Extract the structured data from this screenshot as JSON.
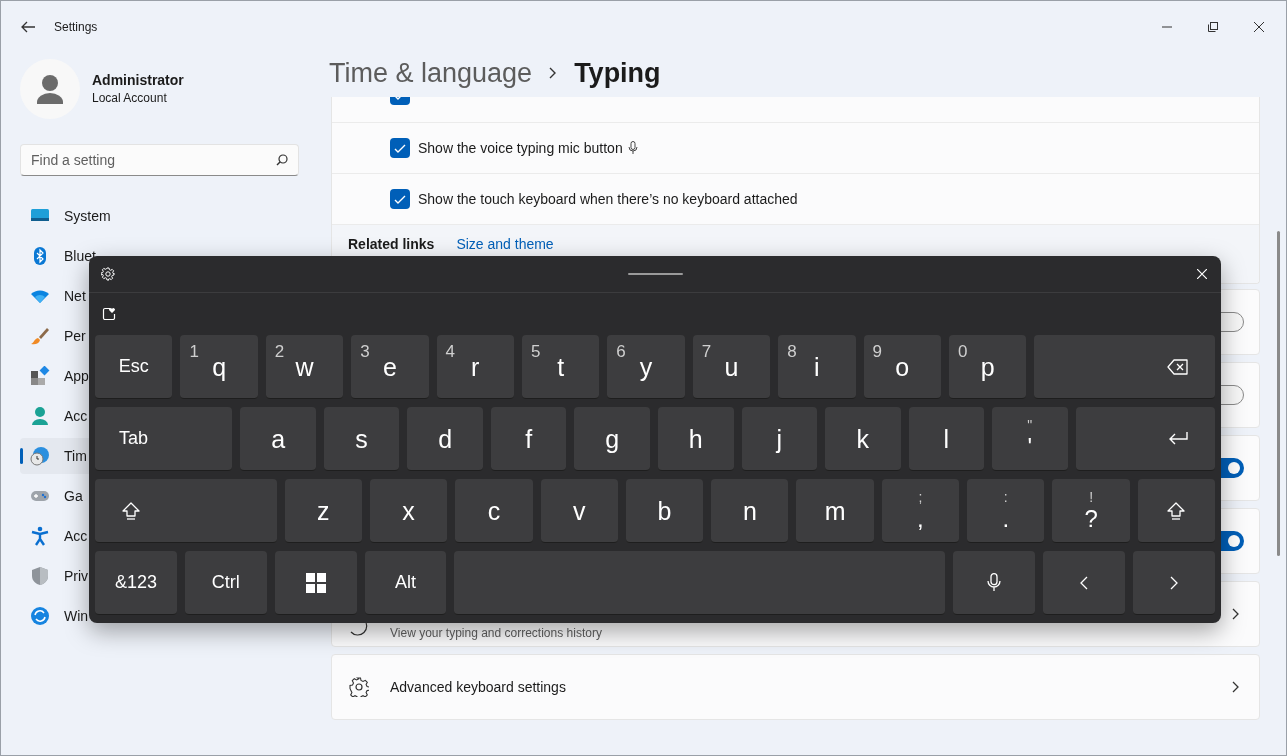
{
  "window": {
    "title": "Settings"
  },
  "account": {
    "name": "Administrator",
    "type": "Local Account"
  },
  "search": {
    "placeholder": "Find a setting"
  },
  "sidebar": {
    "items": [
      {
        "label": "System",
        "selected": false
      },
      {
        "label": "Bluet",
        "selected": false
      },
      {
        "label": "Net",
        "selected": false
      },
      {
        "label": "Per",
        "selected": false
      },
      {
        "label": "App",
        "selected": false
      },
      {
        "label": "Acc",
        "selected": false
      },
      {
        "label": "Tim",
        "selected": true
      },
      {
        "label": "Ga",
        "selected": false
      },
      {
        "label": "Acc",
        "selected": false
      },
      {
        "label": "Priv",
        "selected": false
      },
      {
        "label": "Win",
        "selected": false
      }
    ]
  },
  "breadcrumb": {
    "parent": "Time & language",
    "current": "Typing"
  },
  "checkbox_rows": [
    {
      "kind": "hidden_label",
      "checked": true
    },
    {
      "kind": "mic",
      "label": "Show the voice typing mic button",
      "checked": true
    },
    {
      "kind": "plain",
      "label": "Show the touch keyboard when there’s no keyboard attached",
      "checked": true
    }
  ],
  "related_links": {
    "label": "Related links",
    "links": [
      "Size and theme"
    ]
  },
  "cards": [
    {
      "kind": "toggle",
      "on": false
    },
    {
      "kind": "toggle",
      "on": false
    },
    {
      "kind": "toggle",
      "on": true
    },
    {
      "kind": "toggle",
      "on": true
    },
    {
      "kind": "history",
      "subtitle": "View your typing and corrections history"
    },
    {
      "kind": "gear",
      "title": "Advanced keyboard settings"
    }
  ],
  "keyboard": {
    "rows": [
      [
        {
          "kind": "function",
          "label": "Esc"
        },
        {
          "kind": "char",
          "label": "q",
          "sub": "1"
        },
        {
          "kind": "char",
          "label": "w",
          "sub": "2"
        },
        {
          "kind": "char",
          "label": "e",
          "sub": "3"
        },
        {
          "kind": "char",
          "label": "r",
          "sub": "4"
        },
        {
          "kind": "char",
          "label": "t",
          "sub": "5"
        },
        {
          "kind": "char",
          "label": "y",
          "sub": "6"
        },
        {
          "kind": "char",
          "label": "u",
          "sub": "7"
        },
        {
          "kind": "char",
          "label": "i",
          "sub": "8"
        },
        {
          "kind": "char",
          "label": "o",
          "sub": "9"
        },
        {
          "kind": "char",
          "label": "p",
          "sub": "0"
        },
        {
          "kind": "backspace"
        }
      ],
      [
        {
          "kind": "tab",
          "label": "Tab"
        },
        {
          "kind": "char",
          "label": "a"
        },
        {
          "kind": "char",
          "label": "s"
        },
        {
          "kind": "char",
          "label": "d"
        },
        {
          "kind": "char",
          "label": "f"
        },
        {
          "kind": "char",
          "label": "g"
        },
        {
          "kind": "char",
          "label": "h"
        },
        {
          "kind": "char",
          "label": "j"
        },
        {
          "kind": "char",
          "label": "k"
        },
        {
          "kind": "char",
          "label": "l"
        },
        {
          "kind": "symbol",
          "label": "'",
          "sub": "\""
        },
        {
          "kind": "enter"
        }
      ],
      [
        {
          "kind": "shift_wide"
        },
        {
          "kind": "char",
          "label": "z"
        },
        {
          "kind": "char",
          "label": "x"
        },
        {
          "kind": "char",
          "label": "c"
        },
        {
          "kind": "char",
          "label": "v"
        },
        {
          "kind": "char",
          "label": "b"
        },
        {
          "kind": "char",
          "label": "n"
        },
        {
          "kind": "char",
          "label": "m"
        },
        {
          "kind": "symbol",
          "label": ",",
          "sub": ";"
        },
        {
          "kind": "symbol",
          "label": ".",
          "sub": ":"
        },
        {
          "kind": "symbol",
          "label": "?",
          "sub": "!"
        },
        {
          "kind": "shift"
        }
      ],
      [
        {
          "kind": "function",
          "label": "&123"
        },
        {
          "kind": "function",
          "label": "Ctrl"
        },
        {
          "kind": "windows"
        },
        {
          "kind": "function",
          "label": "Alt"
        },
        {
          "kind": "space"
        },
        {
          "kind": "mic"
        },
        {
          "kind": "left"
        },
        {
          "kind": "right"
        }
      ]
    ]
  }
}
